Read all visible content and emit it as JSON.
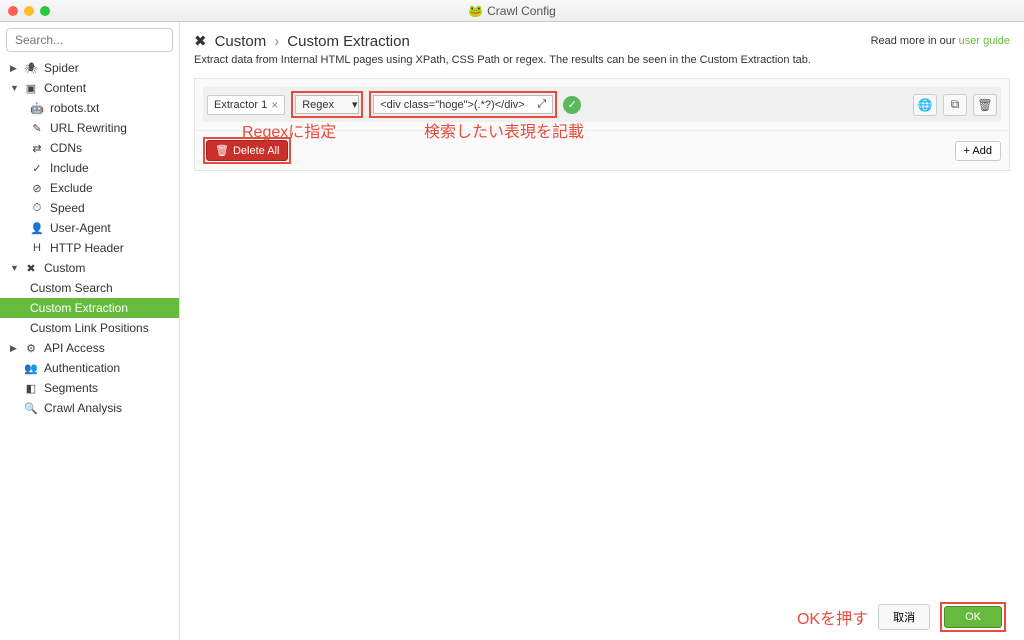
{
  "window": {
    "title": "Crawl Config"
  },
  "sidebar": {
    "search_placeholder": "Search...",
    "items": [
      {
        "label": "Spider",
        "icon": "🕷",
        "caret": "▶"
      },
      {
        "label": "Content",
        "icon": "▣",
        "caret": "▼"
      },
      {
        "label": "robots.txt",
        "icon": "🤖",
        "child": true
      },
      {
        "label": "URL Rewriting",
        "icon": "✎",
        "child": true
      },
      {
        "label": "CDNs",
        "icon": "⇄",
        "child": true
      },
      {
        "label": "Include",
        "icon": "✓",
        "child": true
      },
      {
        "label": "Exclude",
        "icon": "⊘",
        "child": true
      },
      {
        "label": "Speed",
        "icon": "⏱",
        "child": true
      },
      {
        "label": "User-Agent",
        "icon": "👤",
        "child": true
      },
      {
        "label": "HTTP Header",
        "icon": "H",
        "child": true
      },
      {
        "label": "Custom",
        "icon": "✖",
        "caret": "▼"
      },
      {
        "label": "Custom Search",
        "child2": true
      },
      {
        "label": "Custom Extraction",
        "child2": true,
        "active": true
      },
      {
        "label": "Custom Link Positions",
        "child2": true
      },
      {
        "label": "API Access",
        "icon": "⚙",
        "caret": "▶"
      },
      {
        "label": "Authentication",
        "icon": "👥"
      },
      {
        "label": "Segments",
        "icon": "◧"
      },
      {
        "label": "Crawl Analysis",
        "icon": "🔍"
      }
    ]
  },
  "header": {
    "icon": "✖",
    "crumb1": "Custom",
    "sep": "›",
    "crumb2": "Custom Extraction",
    "readmore_prefix": "Read more in our ",
    "readmore_link": "user guide"
  },
  "description": "Extract data from Internal HTML pages using XPath, CSS Path or regex. The results can be seen in the Custom Extraction tab.",
  "extractor": {
    "name": "Extractor 1",
    "mode": "Regex",
    "pattern": "<div class=\"hoge\">(.*?)</div>"
  },
  "annotations": {
    "regex": "Regexに指定",
    "pattern": "検索したい表現を記載",
    "ok": "OKを押す"
  },
  "buttons": {
    "delete_all": "Delete All",
    "add": "+ Add",
    "cancel": "取消",
    "ok": "OK"
  }
}
